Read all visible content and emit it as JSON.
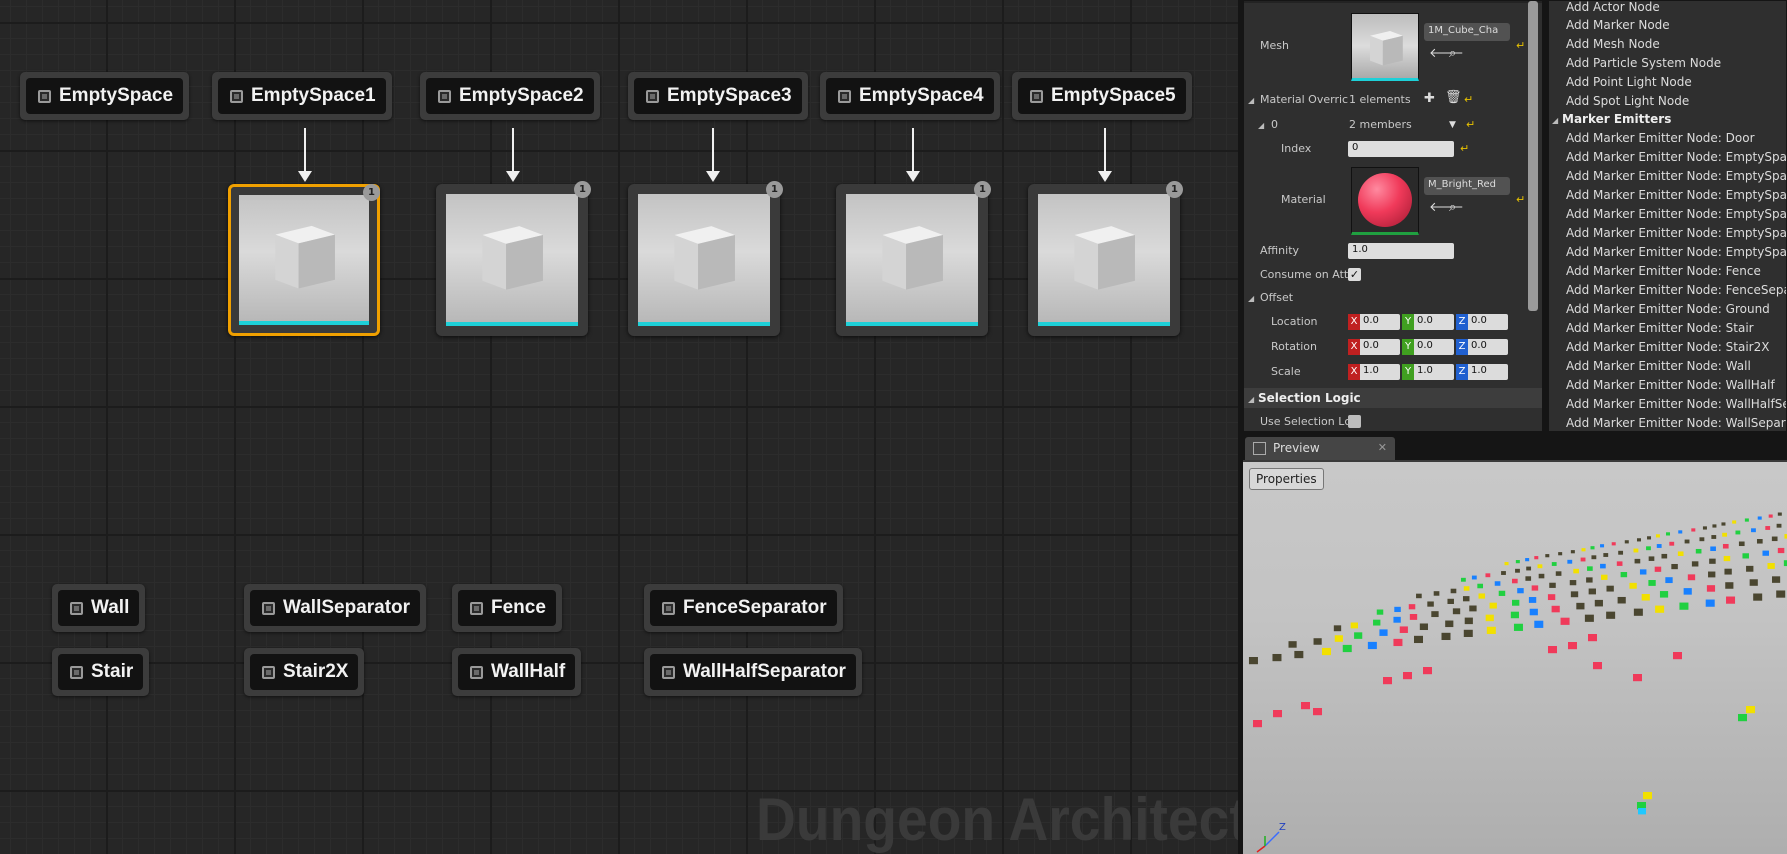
{
  "graph": {
    "markers_top": [
      "EmptySpace",
      "EmptySpace1",
      "EmptySpace2",
      "EmptySpace3",
      "EmptySpace4",
      "EmptySpace5"
    ],
    "markers_bottom": [
      "Wall",
      "WallSeparator",
      "Fence",
      "FenceSeparator",
      "Stair",
      "Stair2X",
      "WallHalf",
      "WallHalfSeparator"
    ],
    "mesh_badge": "1",
    "watermark": "Dungeon Architect"
  },
  "details": {
    "mesh_label": "Mesh",
    "mesh_asset": "1M_Cube_Cha",
    "material_overrides_label": "Material Overric",
    "material_overrides_value": "1 elements",
    "element_index_label": "0",
    "element_members": "2 members",
    "index_label": "Index",
    "index_value": "0",
    "material_label": "Material",
    "material_asset": "M_Bright_Red",
    "affinity_label": "Affinity",
    "affinity_value": "1.0",
    "consume_label": "Consume on Att",
    "offset_label": "Offset",
    "location_label": "Location",
    "rotation_label": "Rotation",
    "scale_label": "Scale",
    "location": [
      "0.0",
      "0.0",
      "0.0"
    ],
    "rotation": [
      "0.0",
      "0.0",
      "0.0"
    ],
    "scale": [
      "1.0",
      "1.0",
      "1.0"
    ],
    "axis": [
      "X",
      "Y",
      "Z"
    ],
    "selection_logic_label": "Selection Logic",
    "use_selection_label": "Use Selection Lc"
  },
  "actions": {
    "items": [
      "Add Actor Node",
      "Add Marker Node",
      "Add Mesh Node",
      "Add Particle System Node",
      "Add Point Light Node",
      "Add Spot Light Node"
    ],
    "category": "Marker Emitters",
    "emitters": [
      "Add Marker Emitter Node: Door",
      "Add Marker Emitter Node: EmptySpace",
      "Add Marker Emitter Node: EmptySpace",
      "Add Marker Emitter Node: EmptySpace",
      "Add Marker Emitter Node: EmptySpace",
      "Add Marker Emitter Node: EmptySpace",
      "Add Marker Emitter Node: EmptySpace",
      "Add Marker Emitter Node: Fence",
      "Add Marker Emitter Node: FenceSeparat",
      "Add Marker Emitter Node: Ground",
      "Add Marker Emitter Node: Stair",
      "Add Marker Emitter Node: Stair2X",
      "Add Marker Emitter Node: Wall",
      "Add Marker Emitter Node: WallHalf",
      "Add Marker Emitter Node: WallHalfSepa",
      "Add Marker Emitter Node: WallSeparat"
    ]
  },
  "preview": {
    "tab_label": "Preview",
    "properties_label": "Properties",
    "axis_z": "Z",
    "colors": {
      "red": "#f03a5a",
      "yellow": "#f2e000",
      "green": "#20d040",
      "blue": "#1880ff",
      "dark": "#4a4630",
      "cyan": "#20c8ff"
    }
  },
  "ui_colors": {
    "selection": "#f0a000",
    "mesh_strip": "#1ed0d8",
    "reset_arrow": "#e8c200"
  }
}
